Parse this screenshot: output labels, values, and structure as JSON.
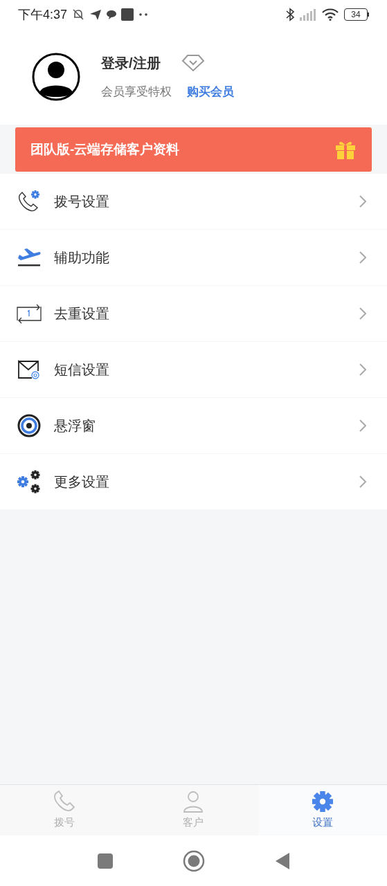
{
  "status_bar": {
    "time": "下午4:37",
    "battery": "34"
  },
  "profile": {
    "title": "登录/注册",
    "subtitle": "会员享受特权",
    "link": "购买会员"
  },
  "banner": {
    "text": "团队版-云端存储客户资料"
  },
  "menu": [
    {
      "kind": "dial",
      "label": "拨号设置"
    },
    {
      "kind": "assist",
      "label": "辅助功能"
    },
    {
      "kind": "dedupe",
      "label": "去重设置"
    },
    {
      "kind": "sms",
      "label": "短信设置"
    },
    {
      "kind": "float",
      "label": "悬浮窗"
    },
    {
      "kind": "more",
      "label": "更多设置"
    }
  ],
  "tabs": [
    {
      "kind": "dial",
      "label": "拨号",
      "selected": false
    },
    {
      "kind": "customer",
      "label": "客户",
      "selected": false
    },
    {
      "kind": "settings",
      "label": "设置",
      "selected": true
    }
  ]
}
